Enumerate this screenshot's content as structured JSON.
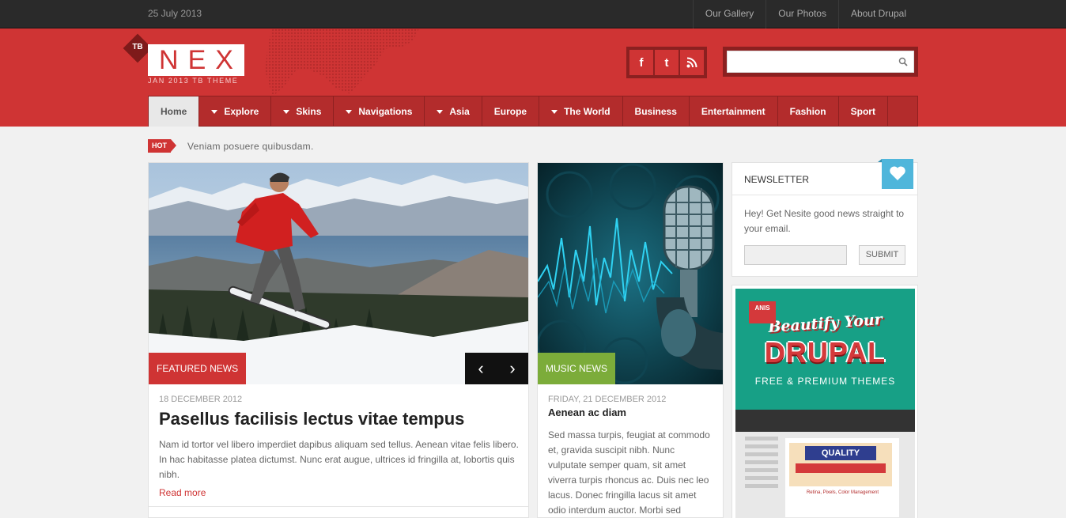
{
  "topbar": {
    "date": "25 July 2013",
    "links": [
      "Our Gallery",
      "Our Photos",
      "About Drupal"
    ]
  },
  "logo": {
    "badge": "TB",
    "letters": [
      "N",
      "E",
      "X"
    ],
    "subtitle": "JAN 2013 TB THEME"
  },
  "social": {
    "icons": [
      "facebook-icon",
      "twitter-icon",
      "rss-icon"
    ],
    "glyphs": [
      "f",
      "t",
      ""
    ]
  },
  "search": {
    "placeholder": "",
    "icon": "search-icon"
  },
  "nav": {
    "items": [
      {
        "label": "Home",
        "has_dropdown": false,
        "active": true
      },
      {
        "label": "Explore",
        "has_dropdown": true
      },
      {
        "label": "Skins",
        "has_dropdown": true
      },
      {
        "label": "Navigations",
        "has_dropdown": true
      },
      {
        "label": "Asia",
        "has_dropdown": true
      },
      {
        "label": "Europe",
        "has_dropdown": false
      },
      {
        "label": "The World",
        "has_dropdown": true
      },
      {
        "label": "Business",
        "has_dropdown": false
      },
      {
        "label": "Entertainment",
        "has_dropdown": false
      },
      {
        "label": "Fashion",
        "has_dropdown": false
      },
      {
        "label": "Sport",
        "has_dropdown": false
      }
    ]
  },
  "ticker": {
    "badge": "HOT",
    "text": "Veniam posuere quibusdam."
  },
  "featured": {
    "tag": "FEATURED NEWS",
    "date": "18 DECEMBER 2012",
    "title": "Pasellus facilisis lectus vitae tempus",
    "body": "Nam id tortor vel libero imperdiet dapibus aliquam sed tellus. Aenean vitae felis libero. In hac habitasse platea dictumst. Nunc erat augue, ultrices id fringilla at, lobortis quis nibh.",
    "more": "Read more",
    "prev": "‹",
    "next": "›"
  },
  "music": {
    "tag": "MUSIC NEWS",
    "date": "FRIDAY, 21 DECEMBER 2012",
    "title": "Aenean ac diam",
    "body": "Sed massa turpis, feugiat at commodo et, gravida suscipit nibh. Nunc vulputate semper quam, sit amet viverra turpis rhoncus ac. Duis nec leo lacus. Donec fringilla lacus sit amet odio interdum auctor. Morbi sed"
  },
  "newsletter": {
    "title": "NEWSLETTER",
    "text": "Hey! Get Nesite good news straight to your email.",
    "submit": "SUBMIT",
    "email_placeholder": ""
  },
  "ad": {
    "line1": "Beautify Your",
    "line2": "DRUPAL",
    "line3": "FREE & PREMIUM THEMES",
    "badge": "ANIS",
    "quality": "QUALITY",
    "caption": "Retina, Pixels, Color Management"
  },
  "colors": {
    "brand_red": "#cf3434",
    "nav_red": "#b32c2c",
    "music_green": "#7cac3a",
    "heart_blue": "#4fb6db"
  }
}
